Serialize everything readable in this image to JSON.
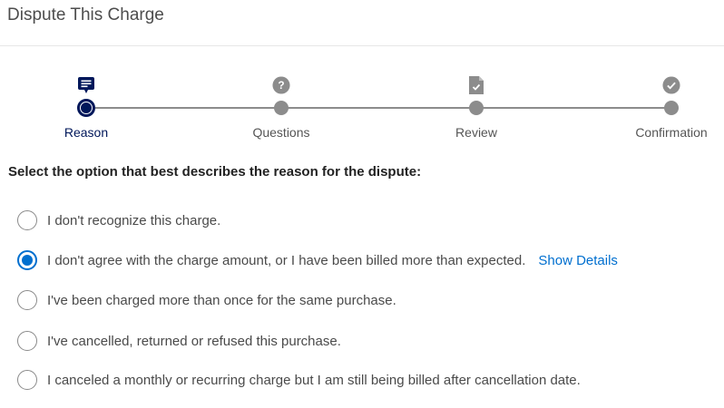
{
  "header": {
    "title": "Dispute This Charge"
  },
  "stepper": {
    "steps": [
      {
        "label": "Reason",
        "icon": "chat-icon",
        "state": "active"
      },
      {
        "label": "Questions",
        "icon": "question-icon",
        "state": "pending"
      },
      {
        "label": "Review",
        "icon": "document-check-icon",
        "state": "pending"
      },
      {
        "label": "Confirmation",
        "icon": "checkmark-icon",
        "state": "pending"
      }
    ]
  },
  "prompt": "Select the option that best describes the reason for the dispute:",
  "options": [
    {
      "label": "I don't recognize this charge.",
      "checked": false
    },
    {
      "label": "I don't agree with the charge amount, or I have been billed more than expected.",
      "checked": true,
      "link": "Show Details"
    },
    {
      "label": "I've been charged more than once for the same purchase.",
      "checked": false
    },
    {
      "label": "I've cancelled, returned or refused this purchase.",
      "checked": false
    },
    {
      "label": "I canceled a monthly or recurring charge but I am still being billed after cancellation date.",
      "checked": false
    }
  ],
  "colors": {
    "brand_navy": "#00175a",
    "link_blue": "#006fcf",
    "inactive_gray": "#8c8c8c"
  }
}
